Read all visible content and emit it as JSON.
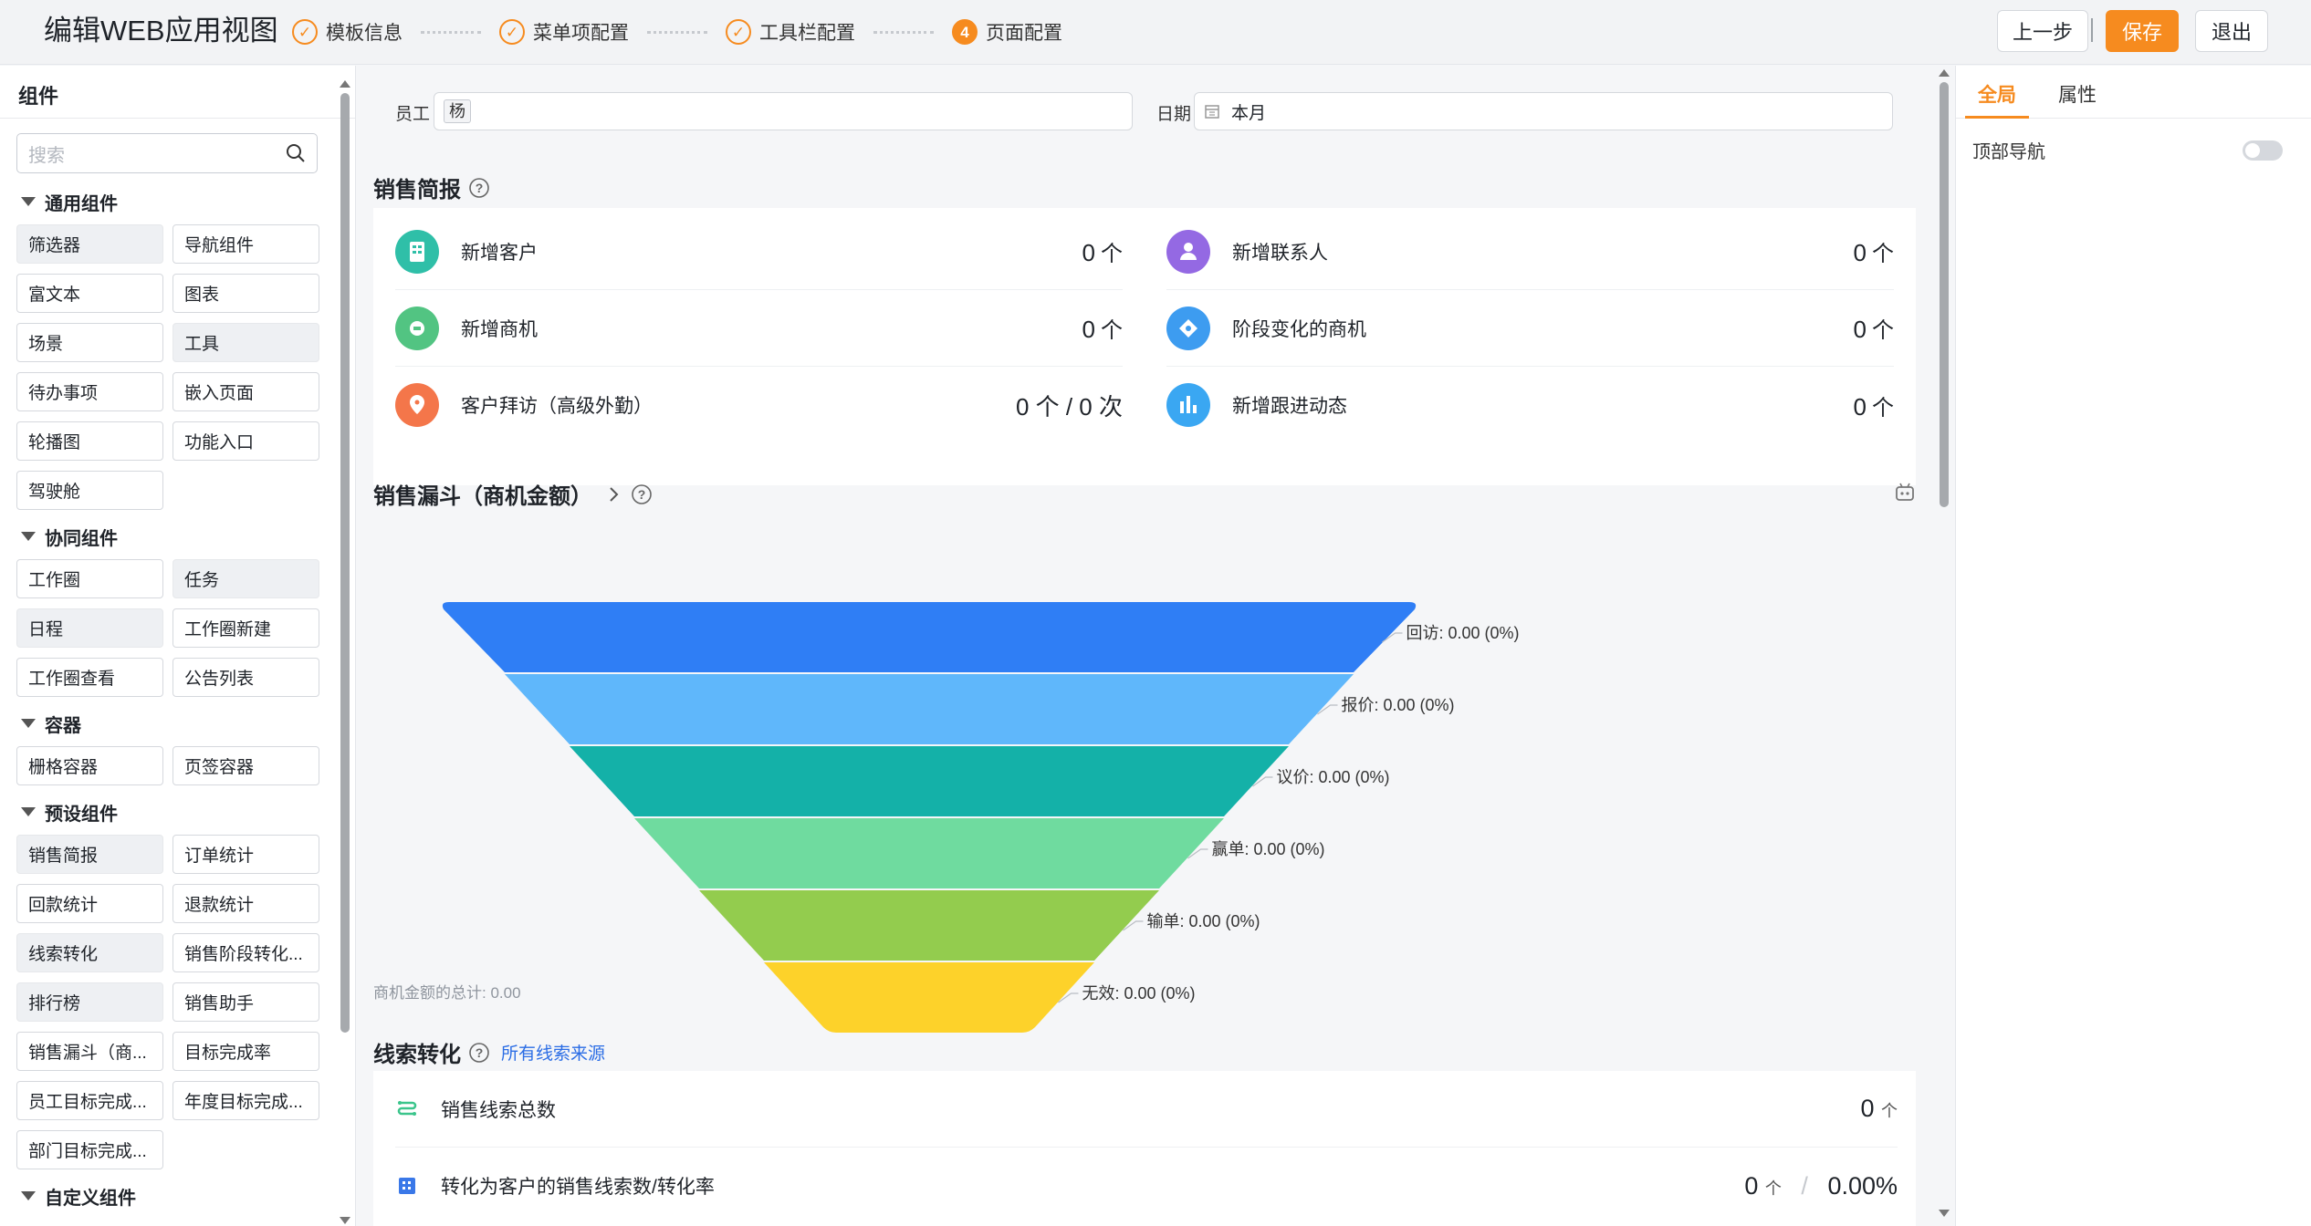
{
  "header": {
    "title": "编辑WEB应用视图",
    "steps": [
      {
        "label": "模板信息",
        "state": "done"
      },
      {
        "label": "菜单项配置",
        "state": "done"
      },
      {
        "label": "工具栏配置",
        "state": "done"
      },
      {
        "label": "页面配置",
        "state": "active",
        "number": "4"
      }
    ],
    "buttons": {
      "prev": "上一步",
      "save": "保存",
      "exit": "退出"
    },
    "separator": "|"
  },
  "left_panel": {
    "title": "组件",
    "search_placeholder": "搜索",
    "categories": [
      {
        "title": "通用组件",
        "items": [
          {
            "label": "筛选器",
            "selected": true
          },
          {
            "label": "导航组件",
            "selected": false
          },
          {
            "label": "富文本",
            "selected": false
          },
          {
            "label": "图表",
            "selected": false
          },
          {
            "label": "场景",
            "selected": false
          },
          {
            "label": "工具",
            "selected": true
          },
          {
            "label": "待办事项",
            "selected": false
          },
          {
            "label": "嵌入页面",
            "selected": false
          },
          {
            "label": "轮播图",
            "selected": false
          },
          {
            "label": "功能入口",
            "selected": false
          },
          {
            "label": "驾驶舱",
            "selected": false
          }
        ]
      },
      {
        "title": "协同组件",
        "items": [
          {
            "label": "工作圈",
            "selected": false
          },
          {
            "label": "任务",
            "selected": true
          },
          {
            "label": "日程",
            "selected": true
          },
          {
            "label": "工作圈新建",
            "selected": false
          },
          {
            "label": "工作圈查看",
            "selected": false
          },
          {
            "label": "公告列表",
            "selected": false
          }
        ]
      },
      {
        "title": "容器",
        "items": [
          {
            "label": "栅格容器",
            "selected": false
          },
          {
            "label": "页签容器",
            "selected": false
          }
        ]
      },
      {
        "title": "预设组件",
        "items": [
          {
            "label": "销售简报",
            "selected": true
          },
          {
            "label": "订单统计",
            "selected": false
          },
          {
            "label": "回款统计",
            "selected": false
          },
          {
            "label": "退款统计",
            "selected": false
          },
          {
            "label": "线索转化",
            "selected": true
          },
          {
            "label": "销售阶段转化...",
            "selected": false
          },
          {
            "label": "排行榜",
            "selected": true
          },
          {
            "label": "销售助手",
            "selected": false
          },
          {
            "label": "销售漏斗（商...",
            "selected": false
          },
          {
            "label": "目标完成率",
            "selected": false
          },
          {
            "label": "员工目标完成...",
            "selected": false
          },
          {
            "label": "年度目标完成...",
            "selected": false
          },
          {
            "label": "部门目标完成...",
            "selected": false
          }
        ]
      },
      {
        "title": "自定义组件",
        "items": []
      }
    ]
  },
  "filters": {
    "employee_label": "员工",
    "employee_tag": "杨",
    "date_label": "日期",
    "date_value": "本月"
  },
  "sales_brief": {
    "title": "销售简报",
    "left": [
      {
        "label": "新增客户",
        "value": "0",
        "unit": "个",
        "icon": "customer-icon",
        "color": "#2fbfa8"
      },
      {
        "label": "新增商机",
        "value": "0",
        "unit": "个",
        "icon": "opportunity-icon",
        "color": "#52c482"
      },
      {
        "label": "客户拜访（高级外勤）",
        "value": "0 个 / 0 次",
        "unit": "",
        "icon": "location-pin-icon",
        "color": "#f4764a"
      }
    ],
    "right": [
      {
        "label": "新增联系人",
        "value": "0",
        "unit": "个",
        "icon": "person-icon",
        "color": "#9469e3"
      },
      {
        "label": "阶段变化的商机",
        "value": "0",
        "unit": "个",
        "icon": "stage-diamond-icon",
        "color": "#3d9cf0"
      },
      {
        "label": "新增跟进动态",
        "value": "0",
        "unit": "个",
        "icon": "bar-chart-icon",
        "color": "#3aa7f2"
      }
    ]
  },
  "funnel": {
    "title": "销售漏斗（商机金额）",
    "total_caption": "商机金额的总计: 0.00"
  },
  "chart_data": {
    "type": "funnel",
    "stages": [
      {
        "name": "回访",
        "value": 0.0,
        "percent": 0,
        "label": "回访: 0.00 (0%)",
        "color": "#2f7ef5"
      },
      {
        "name": "报价",
        "value": 0.0,
        "percent": 0,
        "label": "报价: 0.00 (0%)",
        "color": "#5fb7fb"
      },
      {
        "name": "议价",
        "value": 0.0,
        "percent": 0,
        "label": "议价: 0.00 (0%)",
        "color": "#14b1a8"
      },
      {
        "name": "赢单",
        "value": 0.0,
        "percent": 0,
        "label": "赢单: 0.00 (0%)",
        "color": "#6fdb9f"
      },
      {
        "name": "输单",
        "value": 0.0,
        "percent": 0,
        "label": "输单: 0.00 (0%)",
        "color": "#93cc4e"
      },
      {
        "name": "无效",
        "value": 0.0,
        "percent": 0,
        "label": "无效: 0.00 (0%)",
        "color": "#fdd22a"
      }
    ]
  },
  "lead_conversion": {
    "title": "线索转化",
    "link": "所有线索来源",
    "rows": [
      {
        "label": "销售线索总数",
        "value": "0",
        "unit": "个"
      },
      {
        "label": "转化为客户的销售线索数/转化率",
        "value": "0",
        "unit": "个",
        "rate": "0.00%"
      }
    ]
  },
  "right_panel": {
    "tabs": [
      "全局",
      "属性"
    ],
    "active_tab": "全局",
    "top_nav_label": "顶部导航",
    "top_nav_enabled": false
  },
  "colors": {
    "accent": "#f68b1f",
    "link": "#2b6de5"
  }
}
